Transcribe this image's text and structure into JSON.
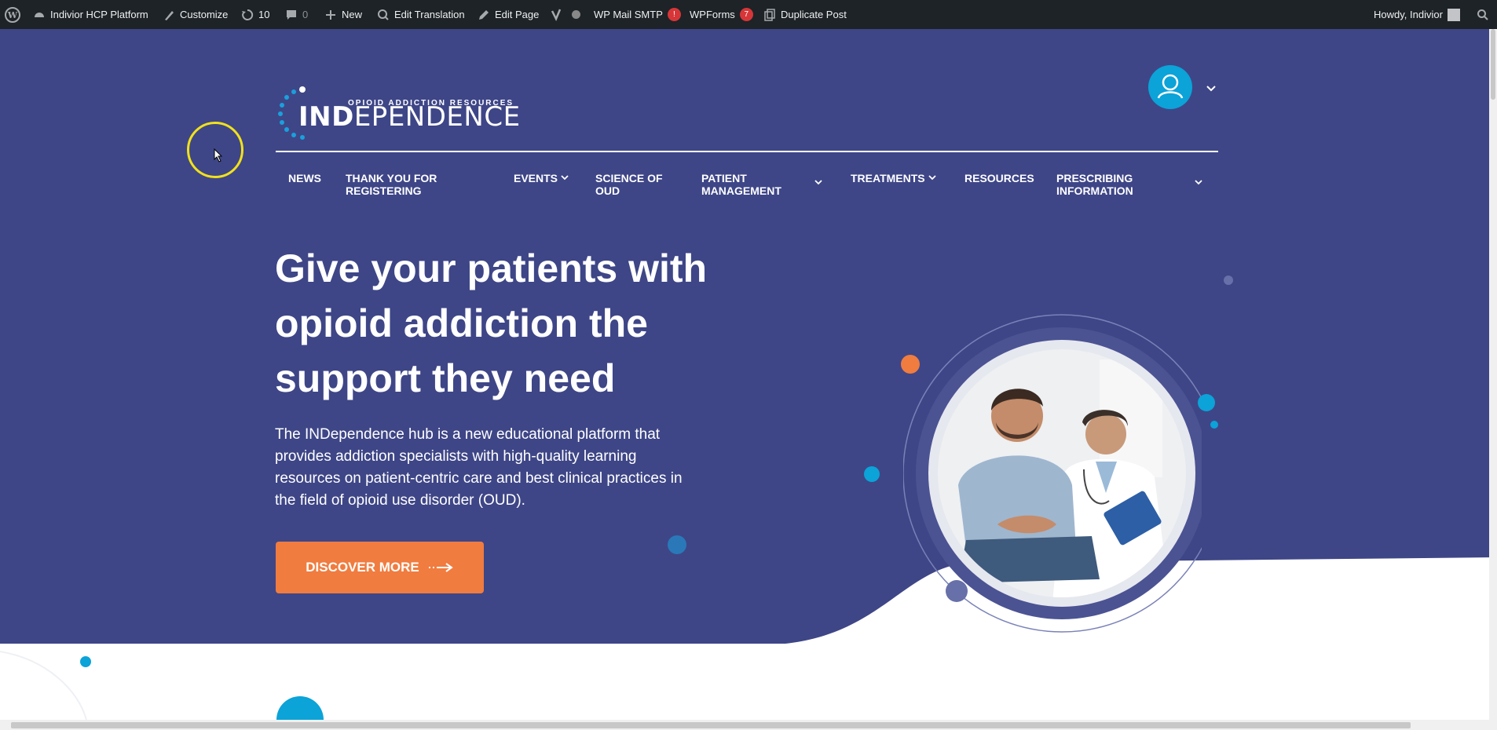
{
  "admin_bar": {
    "site_name": "Indivior HCP Platform",
    "customize": "Customize",
    "updates_count": "10",
    "comments_count": "0",
    "new": "New",
    "edit_translation": "Edit Translation",
    "edit_page": "Edit Page",
    "wp_mail_smtp": "WP Mail SMTP",
    "wp_mail_smtp_badge": "!",
    "wpforms": "WPForms",
    "wpforms_badge": "7",
    "duplicate_post": "Duplicate Post",
    "howdy": "Howdy, Indivior"
  },
  "logo": {
    "text_bold": "IND",
    "text_light": "EPENDENCE",
    "tagline": "OPIOID ADDICTION RESOURCES"
  },
  "nav": {
    "items": [
      {
        "line1": "NEWS",
        "line2": ""
      },
      {
        "line1": "THANK YOU FOR",
        "line2": "REGISTERING"
      },
      {
        "line1": "EVENTS",
        "line2": ""
      },
      {
        "line1": "SCIENCE OF",
        "line2": "OUD"
      },
      {
        "line1": "PATIENT",
        "line2": "MANAGEMENT"
      },
      {
        "line1": "TREATMENTS",
        "line2": ""
      },
      {
        "line1": "RESOURCES",
        "line2": ""
      },
      {
        "line1": "PRESCRIBING",
        "line2": "INFORMATION"
      }
    ]
  },
  "hero": {
    "title_line1": "Give your patients with",
    "title_line2": "opioid addiction the",
    "title_line3": "support they need",
    "desc_line1": "The INDependence hub is a new educational platform that",
    "desc_line2": "provides addiction specialists with high-quality learning",
    "desc_line3": "resources on patient-centric care and best clinical practices in",
    "desc_line4": "the field of opioid use disorder (OUD).",
    "cta_label": "DISCOVER MORE"
  },
  "colors": {
    "admin_bar": "#1d2327",
    "hero_bg": "#3e4687",
    "accent_orange": "#f07c3f",
    "accent_blue": "#0ba3d8"
  },
  "icons": [
    "wordpress-icon",
    "dashboard-icon",
    "brush-icon",
    "updates-icon",
    "comment-icon",
    "plus-icon",
    "translation-icon",
    "pencil-icon",
    "yoast-icon",
    "search-icon",
    "user-icon",
    "chevron-down-icon",
    "arrow-right-icon"
  ]
}
